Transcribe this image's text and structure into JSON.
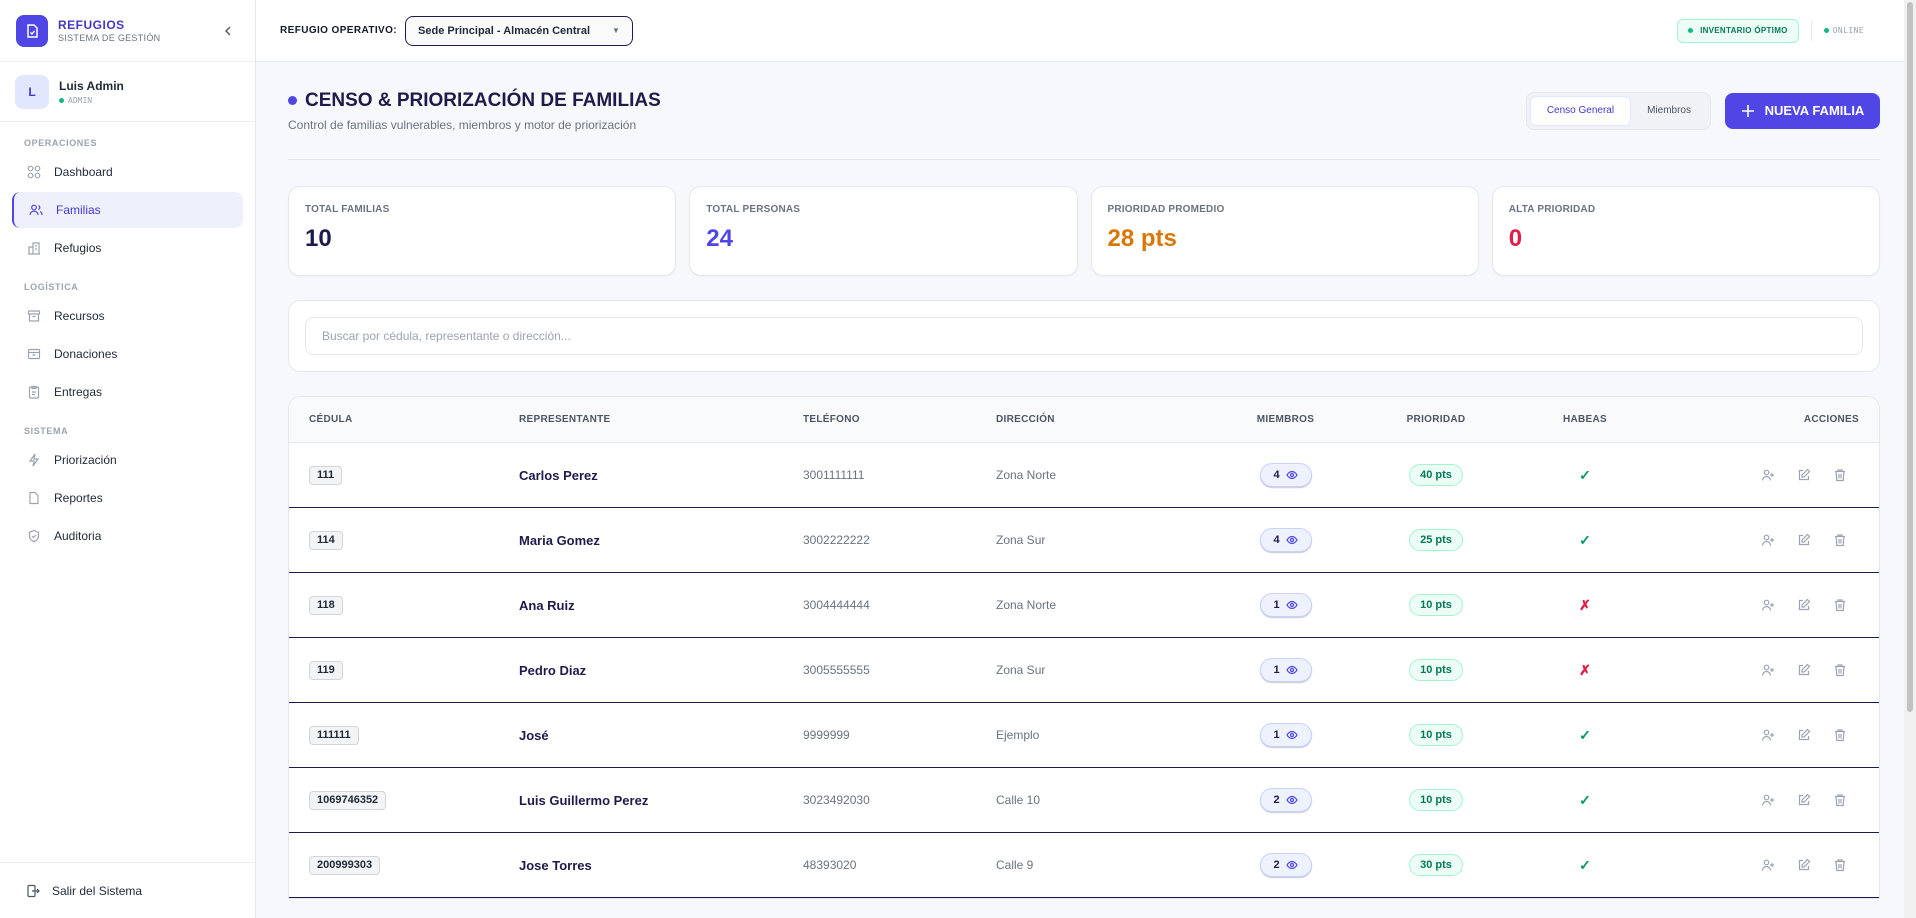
{
  "brand": {
    "title": "REFUGIOS",
    "subtitle": "SISTEMA DE GESTIÓN"
  },
  "user": {
    "initial": "L",
    "name": "Luis Admin",
    "role": "ADMIN"
  },
  "nav": {
    "sections": [
      {
        "label": "OPERACIONES",
        "items": [
          {
            "label": "Dashboard",
            "icon": "grid-icon"
          },
          {
            "label": "Familias",
            "icon": "users-icon",
            "active": true
          },
          {
            "label": "Refugios",
            "icon": "building-icon"
          }
        ]
      },
      {
        "label": "LOGÍSTICA",
        "items": [
          {
            "label": "Recursos",
            "icon": "archive-icon"
          },
          {
            "label": "Donaciones",
            "icon": "box-icon"
          },
          {
            "label": "Entregas",
            "icon": "clipboard-icon"
          }
        ]
      },
      {
        "label": "SISTEMA",
        "items": [
          {
            "label": "Priorización",
            "icon": "bolt-icon"
          },
          {
            "label": "Reportes",
            "icon": "file-icon"
          },
          {
            "label": "Auditoria",
            "icon": "shield-icon"
          }
        ]
      }
    ],
    "logout": "Salir del Sistema"
  },
  "topbar": {
    "refugio_label": "REFUGIO OPERATIVO:",
    "refugio_value": "Sede Principal - Almacén Central",
    "inventory_badge": "INVENTARIO ÓPTIMO",
    "status": "ONLINE"
  },
  "page": {
    "title": "CENSO & PRIORIZACIÓN DE FAMILIAS",
    "subtitle": "Control de familias vulnerables, miembros y motor de priorización",
    "tabs": [
      "Censo General",
      "Miembros"
    ],
    "new_button": "NUEVA FAMILIA"
  },
  "stats": [
    {
      "label": "TOTAL FAMILIAS",
      "value": "10",
      "color": "#1e1b4b"
    },
    {
      "label": "TOTAL PERSONAS",
      "value": "24",
      "color": "#4f46e5"
    },
    {
      "label": "PRIORIDAD PROMEDIO",
      "value": "28 pts",
      "color": "#d97706"
    },
    {
      "label": "ALTA PRIORIDAD",
      "value": "0",
      "color": "#e11d48"
    }
  ],
  "search": {
    "placeholder": "Buscar por cédula, representante o dirección..."
  },
  "table": {
    "headers": [
      "CÉDULA",
      "REPRESENTANTE",
      "TELÉFONO",
      "DIRECCIÓN",
      "MIEMBROS",
      "PRIORIDAD",
      "HABEAS",
      "ACCIONES"
    ],
    "rows": [
      {
        "cedula": "111",
        "representante": "Carlos Perez",
        "telefono": "3001111111",
        "direccion": "Zona Norte",
        "miembros": "4",
        "prioridad": "40 pts",
        "habeas": true
      },
      {
        "cedula": "114",
        "representante": "Maria Gomez",
        "telefono": "3002222222",
        "direccion": "Zona Sur",
        "miembros": "4",
        "prioridad": "25 pts",
        "habeas": true
      },
      {
        "cedula": "118",
        "representante": "Ana Ruiz",
        "telefono": "3004444444",
        "direccion": "Zona Norte",
        "miembros": "1",
        "prioridad": "10 pts",
        "habeas": false
      },
      {
        "cedula": "119",
        "representante": "Pedro Diaz",
        "telefono": "3005555555",
        "direccion": "Zona Sur",
        "miembros": "1",
        "prioridad": "10 pts",
        "habeas": false
      },
      {
        "cedula": "111111",
        "representante": "José",
        "telefono": "9999999",
        "direccion": "Ejemplo",
        "miembros": "1",
        "prioridad": "10 pts",
        "habeas": true
      },
      {
        "cedula": "1069746352",
        "representante": "Luis Guillermo Perez",
        "telefono": "3023492030",
        "direccion": "Calle 10",
        "miembros": "2",
        "prioridad": "10 pts",
        "habeas": true
      },
      {
        "cedula": "200999303",
        "representante": "Jose Torres",
        "telefono": "48393020",
        "direccion": "Calle 9",
        "miembros": "2",
        "prioridad": "30 pts",
        "habeas": true
      }
    ],
    "habeas_yes": "✓",
    "habeas_no": "✗"
  }
}
